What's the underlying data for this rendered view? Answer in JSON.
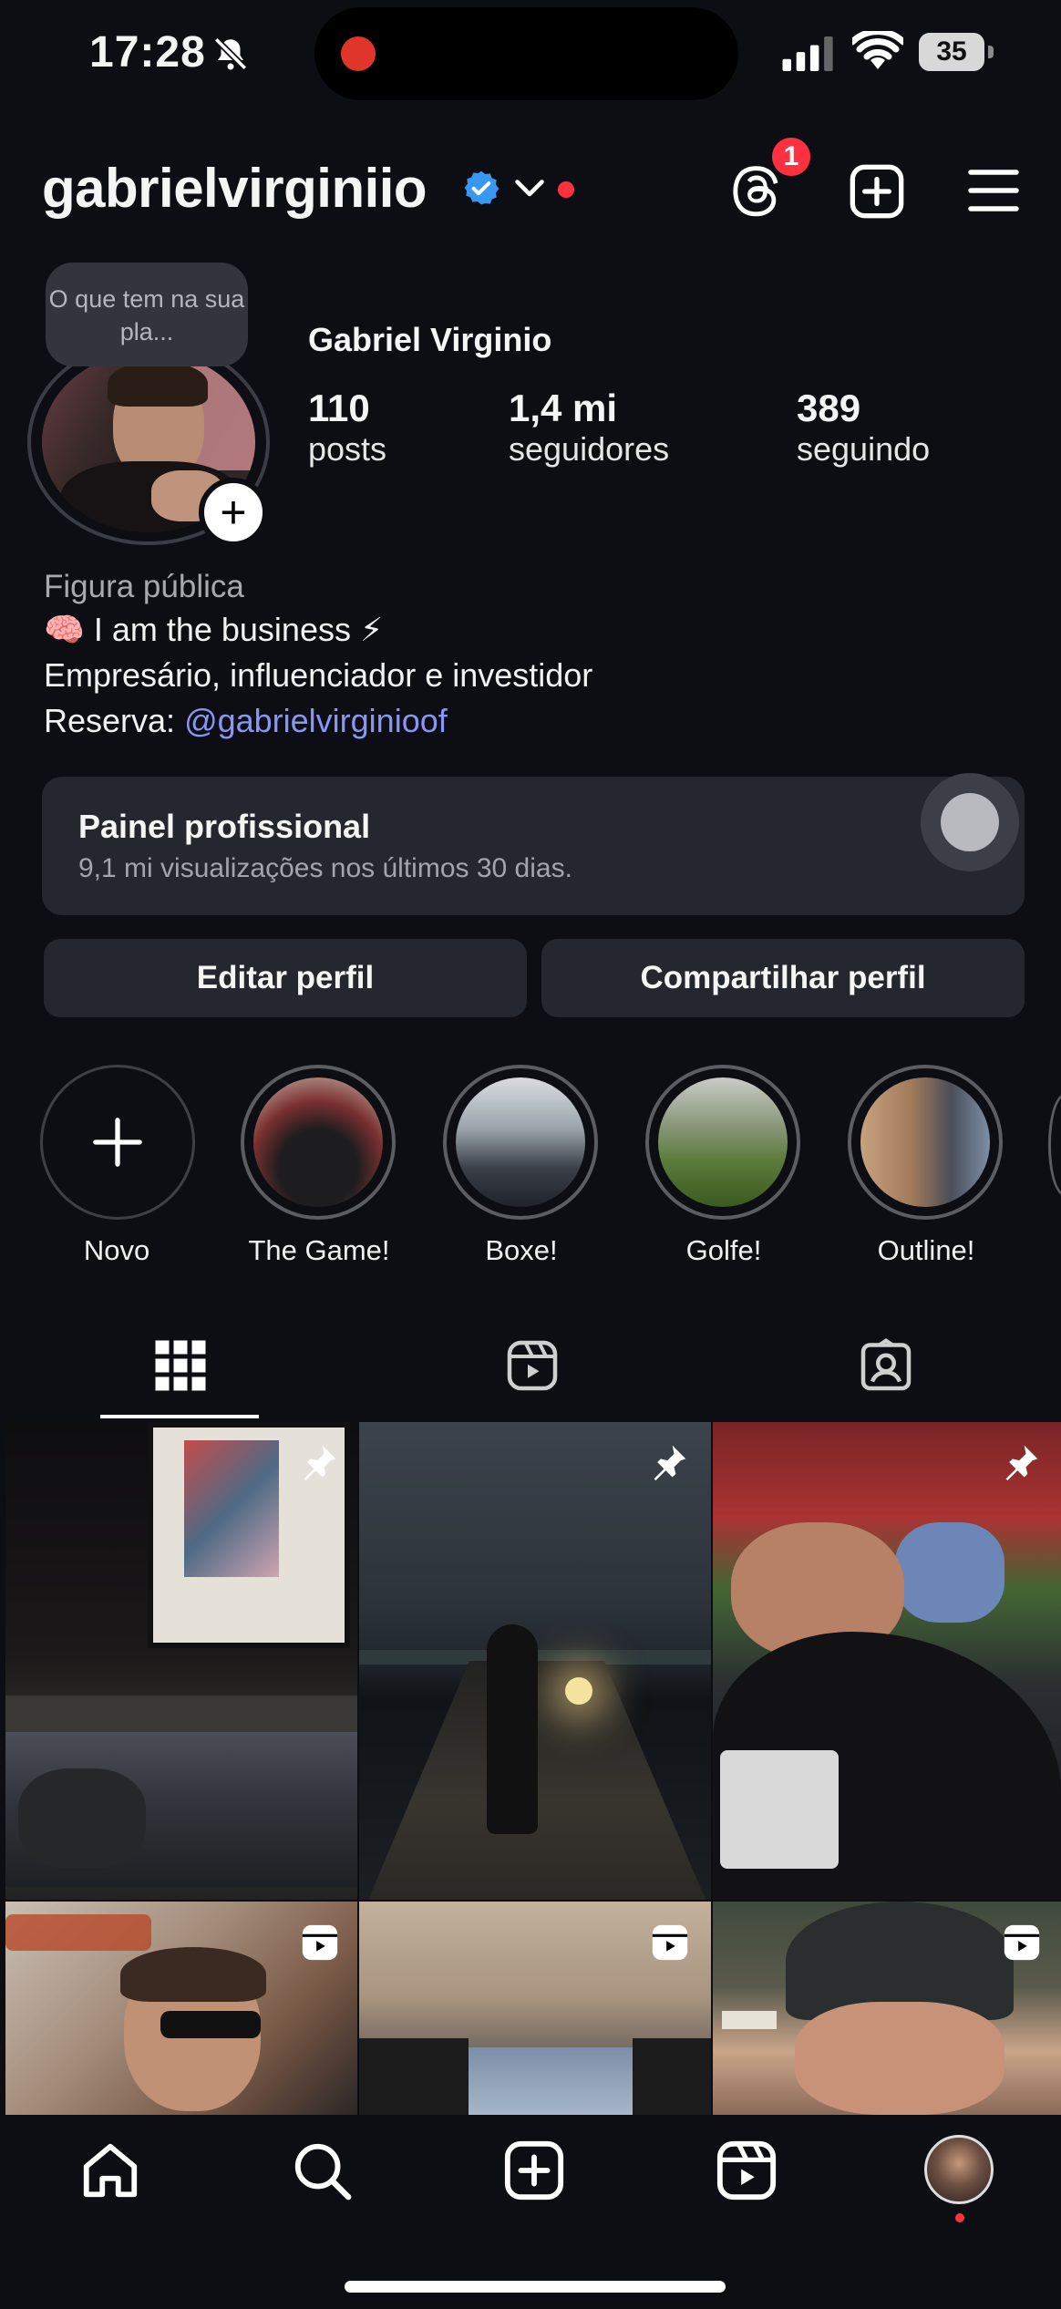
{
  "status_bar": {
    "time": "17:28",
    "battery": "35",
    "icons": [
      "bell-off-icon",
      "recording-dot",
      "signal-icon",
      "wifi-icon",
      "battery-icon"
    ]
  },
  "header": {
    "username": "gabrielvirginiio",
    "notifications_badge": "1",
    "icons": [
      "verified-badge-icon",
      "chevron-down-icon",
      "threads-icon",
      "add-icon",
      "menu-icon"
    ]
  },
  "profile": {
    "note": "O que tem na sua pla...",
    "full_name": "Gabriel Virginio",
    "stats": [
      {
        "value": "110",
        "label": "posts"
      },
      {
        "value": "1,4 mi",
        "label": "seguidores"
      },
      {
        "value": "389",
        "label": "seguindo"
      }
    ],
    "category": "Figura pública",
    "bio_line_1": "🧠 I am the business ⚡",
    "bio_line_2": "Empresário, influenciador e investidor",
    "bio_reserve_label": "Reserva: ",
    "bio_reserve_link": "@gabrielvirginioof"
  },
  "dashboard": {
    "title": "Painel profissional",
    "subtitle": "9,1 mi visualizações nos últimos 30 dias."
  },
  "buttons": {
    "edit": "Editar perfil",
    "share": "Compartilhar perfil"
  },
  "highlights": [
    {
      "label": "Novo"
    },
    {
      "label": "The Game!"
    },
    {
      "label": "Boxe!"
    },
    {
      "label": "Golfe!"
    },
    {
      "label": "Outline!"
    }
  ],
  "tabs": [
    "grid-icon",
    "reels-icon",
    "tagged-icon"
  ],
  "bottom_nav": [
    "home-icon",
    "search-icon",
    "create-icon",
    "reels-icon",
    "profile-avatar"
  ],
  "colors": {
    "background": "#0c0e14",
    "surface": "#24272e",
    "link": "#8b95f3",
    "notification": "#ff3040",
    "verified": "#3897f0"
  }
}
